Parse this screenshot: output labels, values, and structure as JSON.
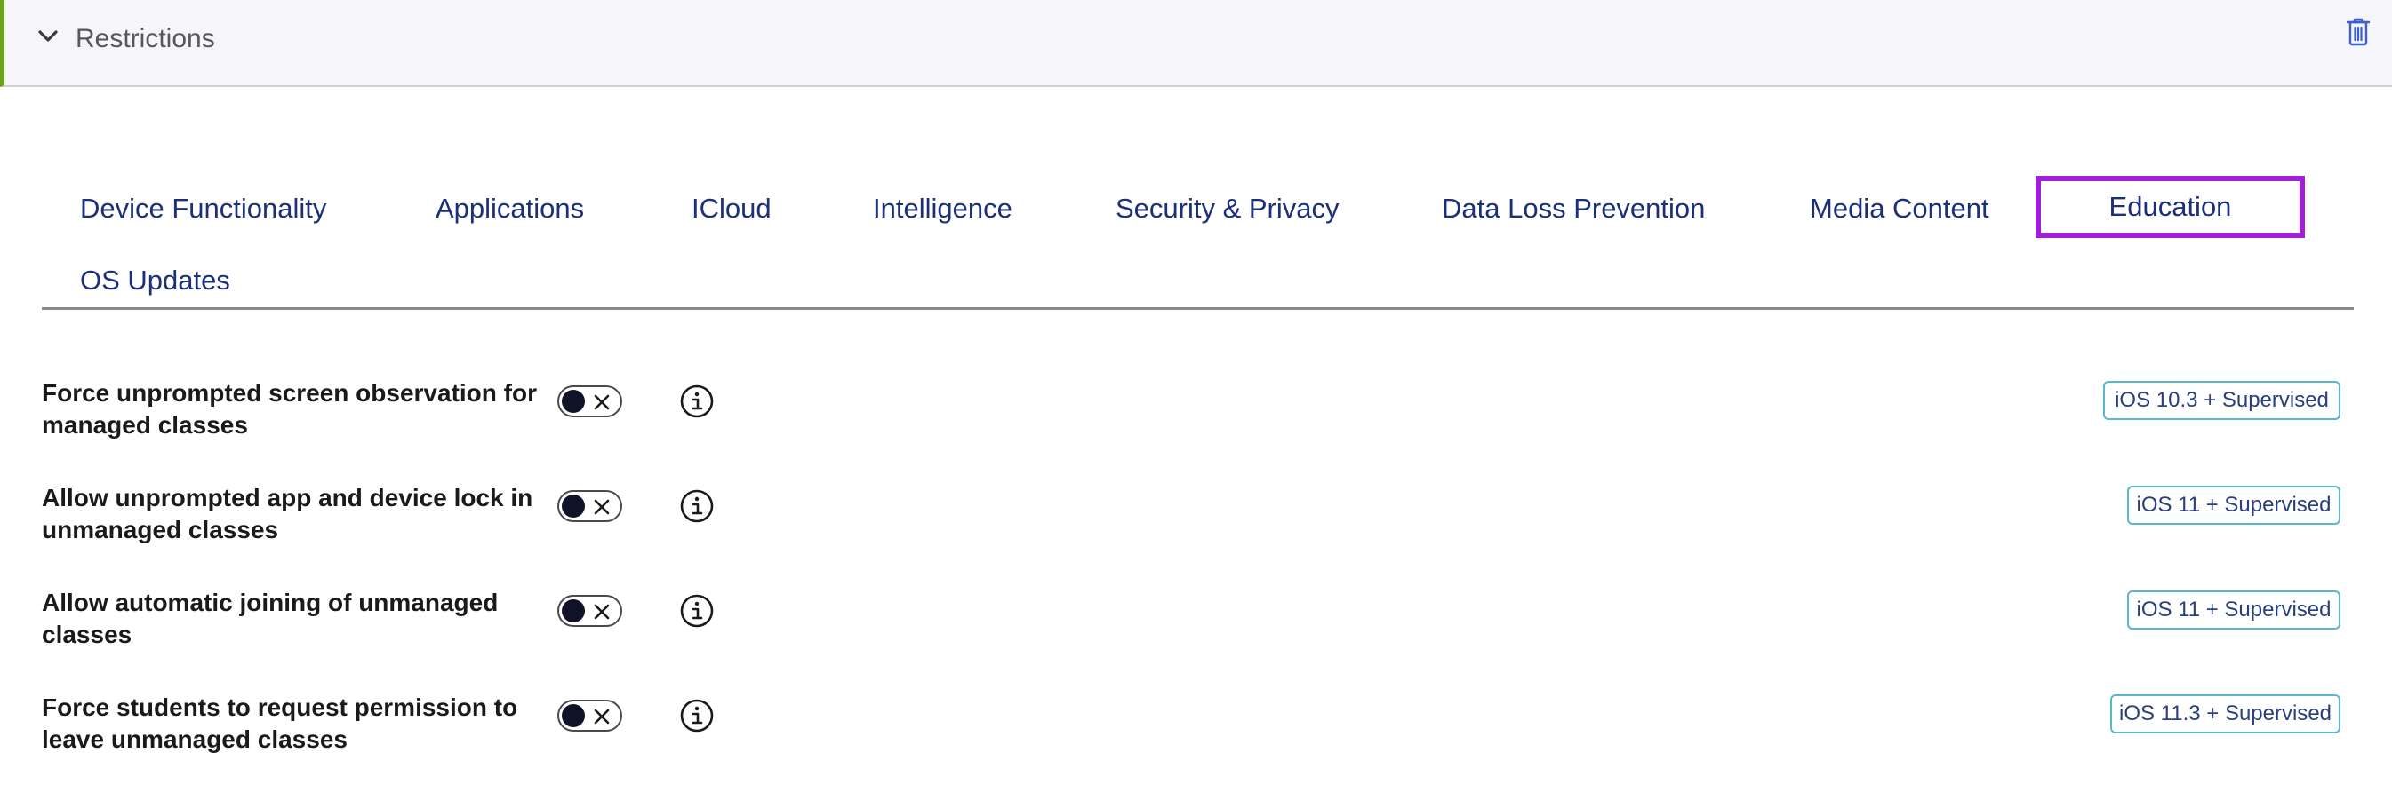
{
  "section": {
    "title": "Restrictions"
  },
  "tabs": [
    {
      "label": "Device Functionality"
    },
    {
      "label": "Applications"
    },
    {
      "label": "ICloud"
    },
    {
      "label": "Intelligence"
    },
    {
      "label": "Security & Privacy"
    },
    {
      "label": "Data Loss Prevention"
    },
    {
      "label": "Media Content"
    },
    {
      "label": "Education"
    },
    {
      "label": "OS Updates"
    }
  ],
  "rows": [
    {
      "label": "Force unprompted screen observation for managed classes",
      "enabled": false,
      "badge": "iOS 10.3 + Supervised"
    },
    {
      "label": "Allow unprompted app and device lock in unmanaged classes",
      "enabled": false,
      "badge": "iOS 11 + Supervised"
    },
    {
      "label": "Allow automatic joining of unmanaged classes",
      "enabled": false,
      "badge": "iOS 11 + Supervised"
    },
    {
      "label": "Force students to request permission to leave unmanaged classes",
      "enabled": false,
      "badge": "iOS 11.3 + Supervised"
    }
  ],
  "colors": {
    "accent_border": "#6aa21c",
    "tab_text": "#1b2f7a",
    "tab_highlight": "#a21fd8",
    "badge_border": "#5ab9c9",
    "toggle_knob": "#101228"
  },
  "icons": {
    "collapse": "chevron-down-icon",
    "delete": "trash-icon",
    "info": "info-icon",
    "toggle_off": "close-icon"
  }
}
